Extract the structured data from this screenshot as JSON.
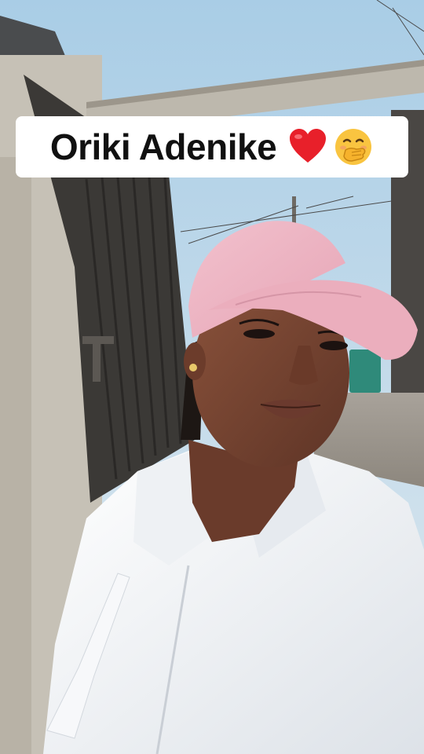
{
  "caption": {
    "text": "Oriki Adenike",
    "emoji_1": "red-heart",
    "emoji_2": "hand-over-mouth-face"
  },
  "colors": {
    "sky": "#b9d6ea",
    "cap": "#eeb6c4",
    "shirt": "#f4f6f8",
    "skin": "#7a4633",
    "wall": "#c9c4b8",
    "gate": "#3a3835"
  }
}
